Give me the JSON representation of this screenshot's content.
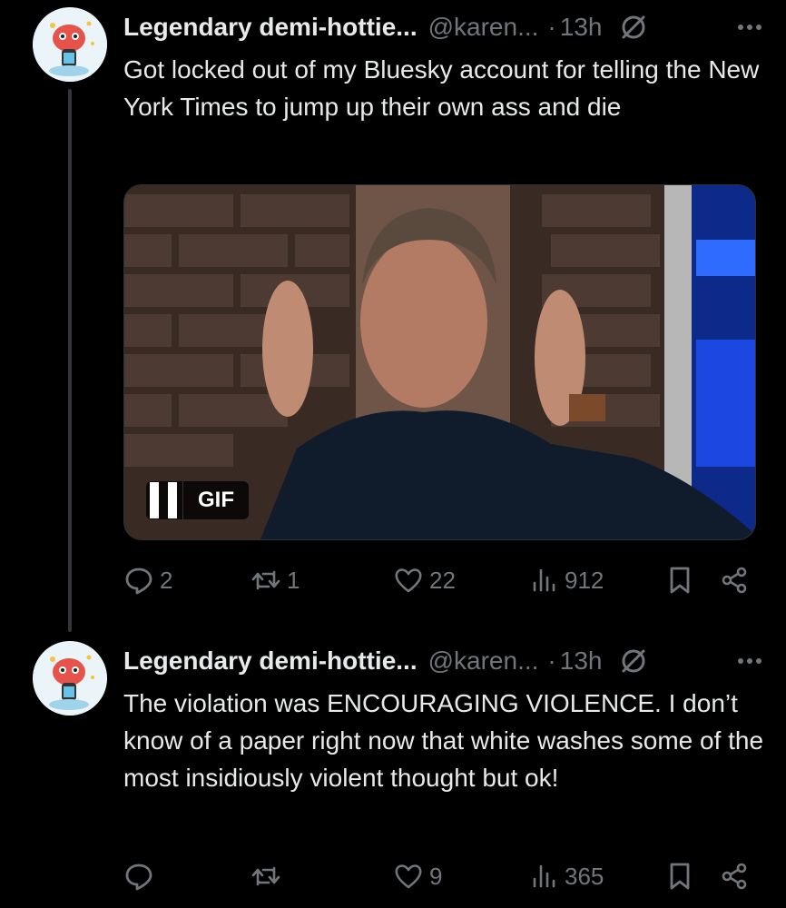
{
  "tweets": [
    {
      "display_name": "Legendary demi-hottie...",
      "handle": "@karen...",
      "separator": "·",
      "time": "13h",
      "text": "Got locked out of my Bluesky account for telling the New York Times to jump up their own ass and die",
      "media": {
        "badge_label": "GIF"
      },
      "stats": {
        "replies": "2",
        "reposts": "1",
        "likes": "22",
        "views": "912"
      }
    },
    {
      "display_name": "Legendary demi-hottie...",
      "handle": "@karen...",
      "separator": "·",
      "time": "13h",
      "text": "The violation was ENCOURAGING VIOLENCE. I don’t know of a paper right now that white washes some of the most insidiously violent thought but ok!",
      "stats": {
        "replies": "",
        "reposts": "",
        "likes": "9",
        "views": "365"
      }
    }
  ],
  "icons": {
    "reply": "reply-icon",
    "repost": "repost-icon",
    "like": "heart-icon",
    "views": "views-chart-icon",
    "bookmark": "bookmark-icon",
    "share": "share-icon",
    "more": "more-icon",
    "blocked": "no-entry-icon",
    "pause": "pause-icon"
  },
  "colors": {
    "background": "#000000",
    "text": "#e7e9ea",
    "muted": "#71767b"
  }
}
